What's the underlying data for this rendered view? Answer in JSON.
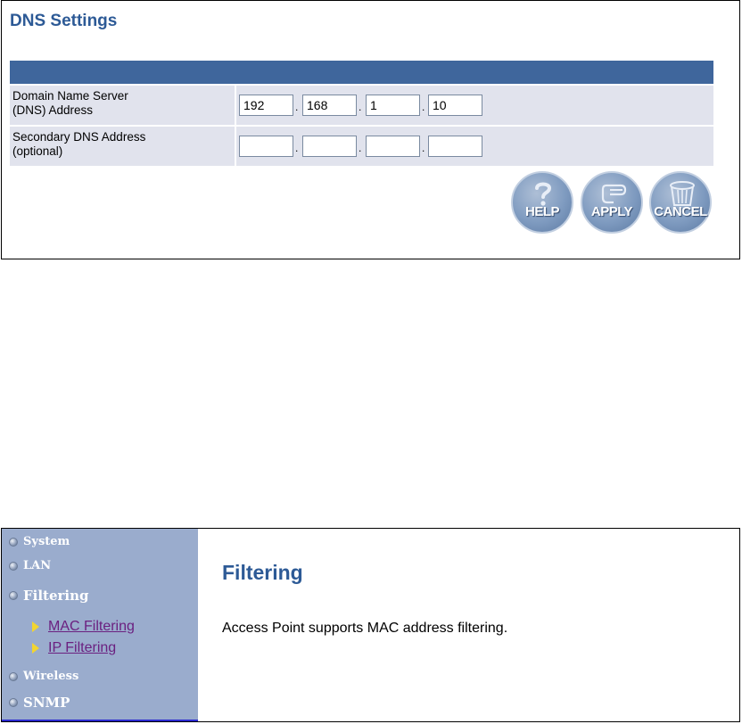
{
  "dns_panel": {
    "title": "DNS Settings",
    "rows": [
      {
        "label_line1": "Domain Name Server",
        "label_line2": "(DNS) Address",
        "octets": [
          "192",
          "168",
          "1",
          "10"
        ]
      },
      {
        "label_line1": "Secondary DNS Address",
        "label_line2": "(optional)",
        "octets": [
          "",
          "",
          "",
          ""
        ]
      }
    ],
    "separator": ".",
    "buttons": {
      "help": "HELP",
      "apply": "APPLY",
      "cancel": "CANCEL"
    },
    "colors": {
      "title": "#2d5a96",
      "header_bar": "#3f669c",
      "row_bg": "#e1e3ed"
    }
  },
  "filter_panel": {
    "sidebar": {
      "items": [
        {
          "label": "System"
        },
        {
          "label": "LAN"
        },
        {
          "label": "Filtering"
        },
        {
          "label": "Wireless"
        },
        {
          "label": "SNMP"
        }
      ],
      "subitems": [
        {
          "label": "MAC Filtering"
        },
        {
          "label": "IP Filtering"
        }
      ]
    },
    "title": "Filtering",
    "description": "Access Point supports MAC address filtering.",
    "colors": {
      "sidebar_bg": "#9aaccd",
      "link": "#6b2080",
      "title": "#2d5a96"
    }
  }
}
